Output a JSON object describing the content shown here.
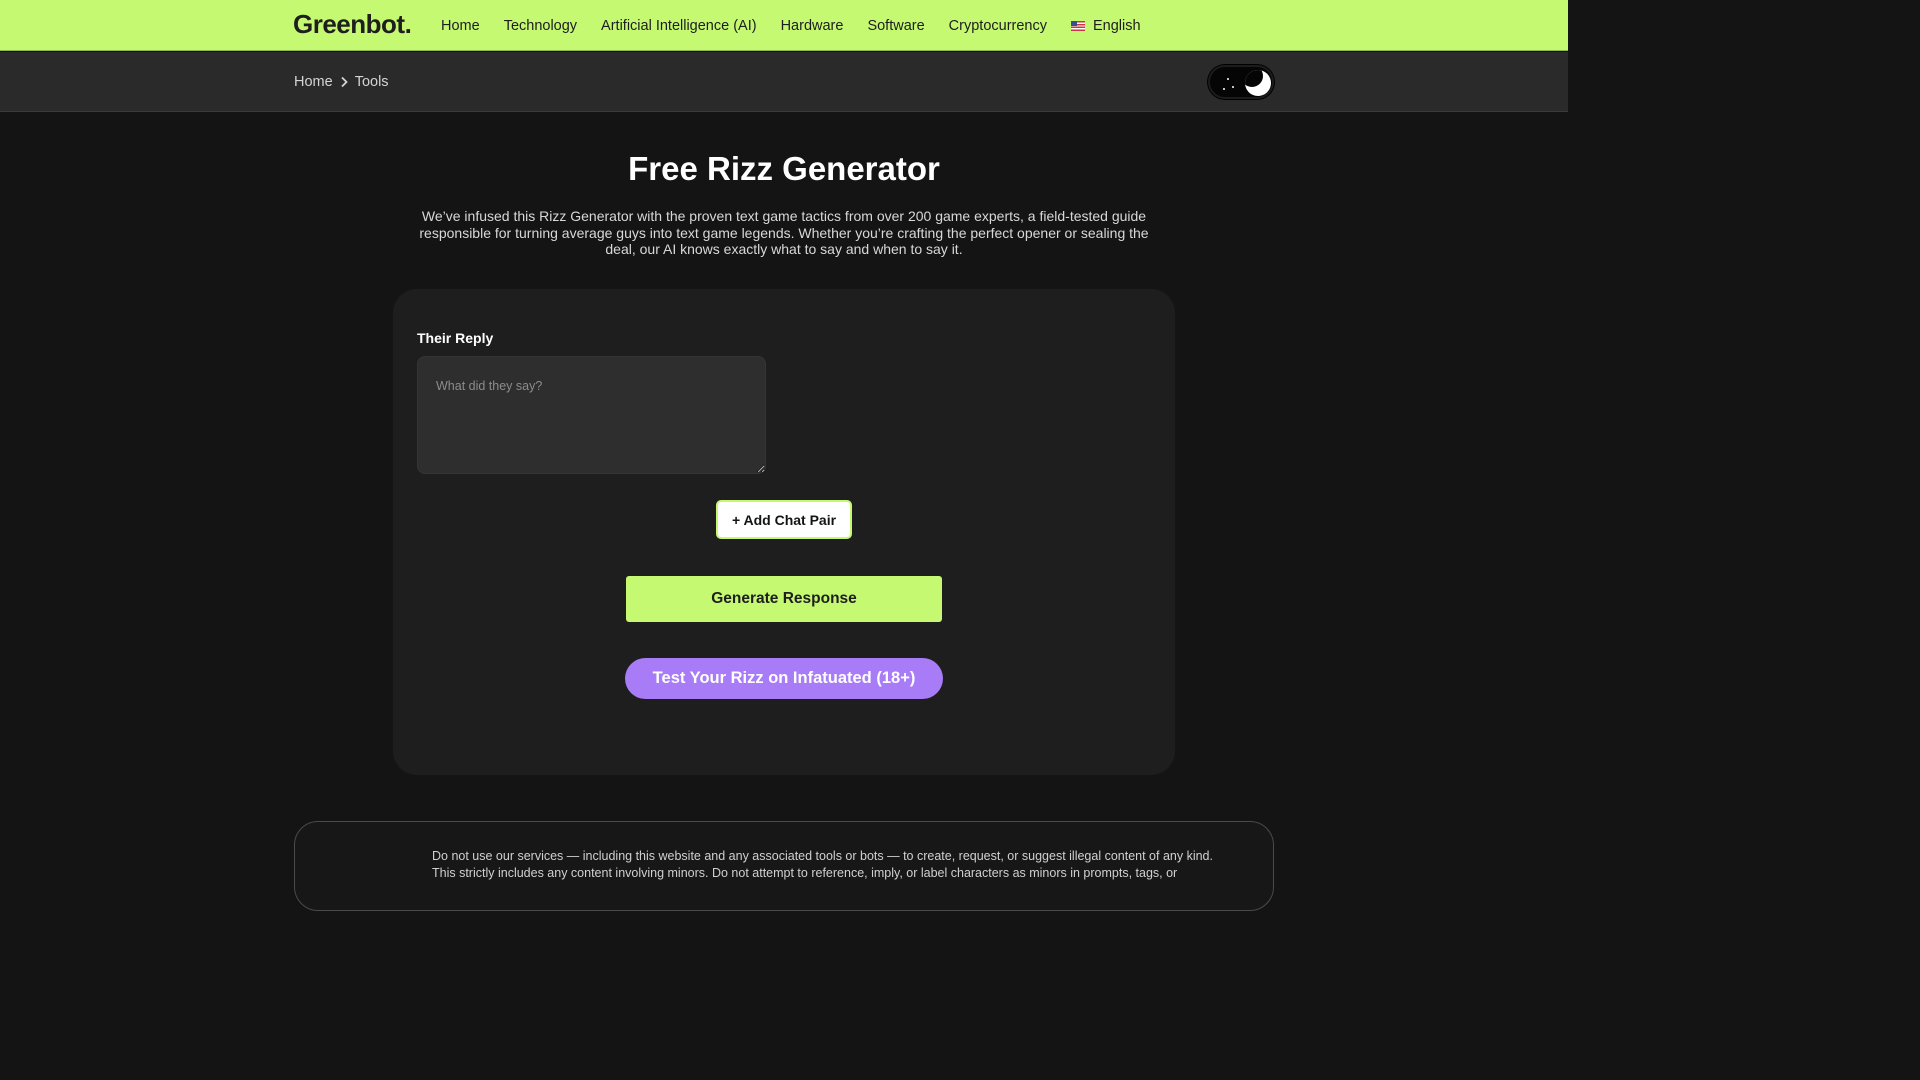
{
  "header": {
    "logo": "Greenbot.",
    "nav": [
      "Home",
      "Technology",
      "Artificial Intelligence (AI)",
      "Hardware",
      "Software",
      "Cryptocurrency"
    ],
    "language": "English",
    "language_icon": "us-flag-icon"
  },
  "breadcrumb": {
    "items": [
      "Home",
      "Tools"
    ],
    "separator_icon": "chevron-right-icon"
  },
  "theme_toggle": {
    "icon": "moon-icon",
    "state": "dark"
  },
  "hero": {
    "title": "Free Rizz Generator",
    "description": "We’ve infused this Rizz Generator with the proven text game tactics from over 200 game experts, a field-tested guide responsible for turning average guys into text game legends. Whether you’re crafting the perfect opener or sealing the deal, our AI knows exactly what to say and when to say it."
  },
  "form": {
    "reply_label": "Their Reply",
    "reply_placeholder": "What did they say?",
    "reply_value": "",
    "add_pair_label": "+ Add Chat Pair",
    "generate_label": "Generate Response",
    "test_label": "Test Your Rizz on Infatuated (18+)"
  },
  "disclaimer": {
    "text": "Do not use our services — including this website and any associated tools or bots — to create, request, or suggest illegal content of any kind. This strictly includes any content involving minors. Do not attempt to reference, imply, or label characters as minors in prompts, tags, or"
  },
  "colors": {
    "accent": "#c6f972",
    "purple": "#a87cf6",
    "background": "#141414",
    "card": "#1e1e1e"
  }
}
